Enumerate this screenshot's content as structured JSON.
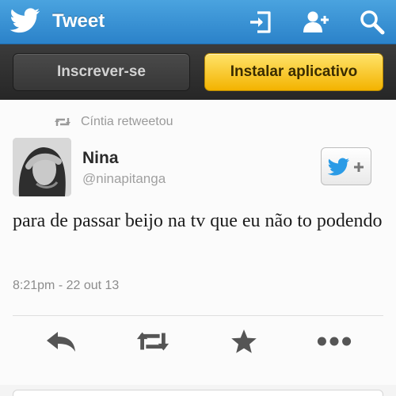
{
  "header": {
    "title": "Tweet",
    "background_color": "#2b82c9",
    "icons": [
      "twitter-bird-icon",
      "sign-in-icon",
      "follow-user-icon",
      "search-icon"
    ]
  },
  "promo": {
    "subscribe_label": "Inscrever-se",
    "install_label": "Instalar aplicativo",
    "install_color": "#f3b300"
  },
  "tweet": {
    "retweeted_by": "Cíntia retweetou",
    "author_name": "Nina",
    "author_handle": "@ninapitanga",
    "text": "para de passar beijo na tv que eu não to podendo",
    "timestamp": "8:21pm - 22 out 13",
    "actions": [
      "reply-icon",
      "retweet-icon",
      "favorite-icon",
      "more-options-icon"
    ]
  }
}
